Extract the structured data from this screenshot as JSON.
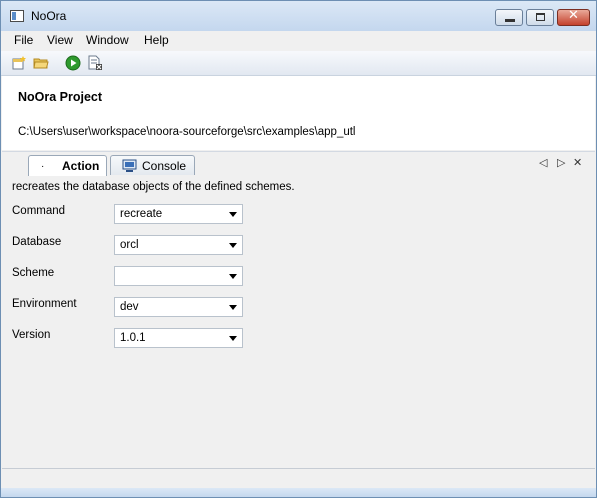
{
  "window": {
    "title": "NoOra",
    "minimize_icon": "minimize-icon",
    "maximize_icon": "maximize-icon",
    "close_icon": "close-icon",
    "close_glyph": "✕"
  },
  "menu": {
    "items": [
      {
        "label": "File"
      },
      {
        "label": "View"
      },
      {
        "label": "Window"
      },
      {
        "label": "Help"
      }
    ]
  },
  "toolbar": {
    "icons": [
      "new-project-icon",
      "open-folder-icon",
      "run-icon",
      "stop-document-icon"
    ]
  },
  "project": {
    "title": "NoOra Project",
    "path": "C:\\Users\\user\\workspace\\noora-sourceforge\\src\\examples\\app_utl"
  },
  "tabs": {
    "active": {
      "label": "Action",
      "dot": "·"
    },
    "console": {
      "label": "Console"
    },
    "controls": {
      "prev": "◁",
      "next": "▷",
      "close": "✕"
    }
  },
  "action": {
    "description": "recreates the database objects of the defined schemes.",
    "fields": [
      {
        "label": "Command",
        "value": "recreate"
      },
      {
        "label": "Database",
        "value": "orcl"
      },
      {
        "label": "Scheme",
        "value": ""
      },
      {
        "label": "Environment",
        "value": "dev"
      },
      {
        "label": "Version",
        "value": "1.0.1"
      }
    ]
  },
  "colors": {
    "titlebar": "#c4d7ee",
    "close_button": "#c4412c",
    "run_green": "#2e9a2e"
  }
}
